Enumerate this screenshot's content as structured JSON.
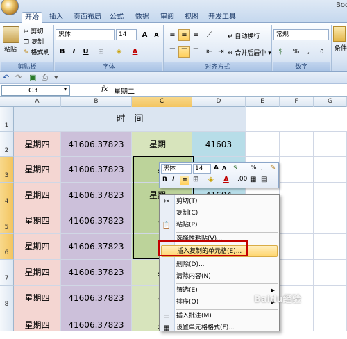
{
  "app": {
    "title_fragment": "Boo"
  },
  "tabs": [
    {
      "label": "开始",
      "active": true
    },
    {
      "label": "插入",
      "active": false
    },
    {
      "label": "页面布局",
      "active": false
    },
    {
      "label": "公式",
      "active": false
    },
    {
      "label": "数据",
      "active": false
    },
    {
      "label": "审阅",
      "active": false
    },
    {
      "label": "视图",
      "active": false
    },
    {
      "label": "开发工具",
      "active": false
    }
  ],
  "ribbon": {
    "clipboard": {
      "paste": "粘贴",
      "cut": "剪切",
      "copy": "复制",
      "format_painter": "格式刷",
      "group": "剪贴板"
    },
    "font": {
      "name": "黑体",
      "size": "14",
      "bold": "B",
      "italic": "I",
      "underline": "U",
      "grow": "A",
      "shrink": "A",
      "font_color": "A",
      "group": "字体"
    },
    "alignment": {
      "wrap": "自动换行",
      "merge": "合并后居中",
      "group": "对齐方式"
    },
    "number": {
      "format": "常规",
      "percent": "%",
      "comma": ",",
      "group": "数字"
    },
    "styles": {
      "label": "条件"
    }
  },
  "formula_bar": {
    "name_box": "C3",
    "fx": "fx",
    "content": "星期二"
  },
  "columns": [
    "A",
    "B",
    "C",
    "D",
    "E",
    "F",
    "G"
  ],
  "rows": [
    "1",
    "2",
    "3",
    "4",
    "5",
    "6",
    "7",
    "8"
  ],
  "header_title": "时　间",
  "cells": {
    "r2": {
      "a": "星期四",
      "b": "41606.37823",
      "c": "星期一",
      "d": "41603"
    },
    "r3": {
      "a": "星期四",
      "b": "41606.37823",
      "c": "星"
    },
    "r4": {
      "a": "星期四",
      "b": "41606.37823",
      "c": "星期三",
      "d": "41604"
    },
    "r5": {
      "a": "星期四",
      "b": "41606.37823",
      "c": "星"
    },
    "r6": {
      "a": "星期四",
      "b": "41606.37823",
      "c": "星"
    },
    "r7": {
      "a": "星期四",
      "b": "41606.37823",
      "c": "星"
    },
    "r8": {
      "a": "星期四",
      "b": "41606.37823",
      "c": "星"
    },
    "r9": {
      "a": "星期四",
      "b": "41606.37823",
      "c": "星"
    }
  },
  "mini_toolbar": {
    "font": "黑体",
    "size": "14",
    "bold": "B",
    "italic": "I",
    "percent": "%",
    "comma": ",",
    "font_color": "A"
  },
  "context_menu": [
    {
      "label": "剪切(T)"
    },
    {
      "label": "复制(C)"
    },
    {
      "label": "粘贴(P)"
    },
    {
      "label": "选择性粘贴(V)..."
    },
    {
      "label": "插入复制的单元格(E)...",
      "highlighted": true
    },
    {
      "label": "删除(D)..."
    },
    {
      "label": "清除内容(N)"
    },
    {
      "label": "筛选(E)",
      "submenu": true
    },
    {
      "label": "排序(O)",
      "submenu": true
    },
    {
      "label": "插入批注(M)"
    },
    {
      "label": "设置单元格格式(F)..."
    }
  ],
  "watermark": "Baidu经验"
}
